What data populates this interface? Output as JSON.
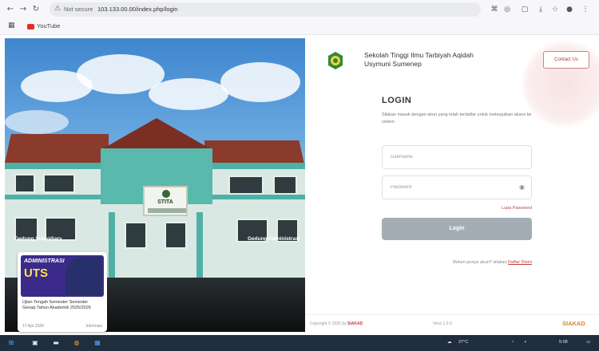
{
  "browser": {
    "url_security": "Not secure",
    "url": "103.133.00.00/index.php/login",
    "bookmark_label": "YouTube",
    "right_icons": [
      "translate-icon",
      "extension-icon",
      "sidebar-icon",
      "download-icon",
      "star-icon",
      "profile-icon",
      "menu-icon"
    ]
  },
  "hero": {
    "sign_name": "STITA",
    "caption_left": "Gedung Subsidiary",
    "caption_right": "Gedung Administrasi",
    "card": {
      "banner_line1": "ADMINISTRASI",
      "banner_line2": "UTS",
      "title": "Ujian Tengah Semester Semester Genap Tahun Akademik 2025/2026",
      "date": "17 Apr 2026",
      "category": "Informasi"
    }
  },
  "header": {
    "institution": "Sekolah Tinggi Ilmu Tarbiyah Aqidah Usymuni Sumenep",
    "contact_label": "Contact Us"
  },
  "login": {
    "title": "LOGIN",
    "description": "Silakan masuk dengan akun yang telah terdaftar untuk melanjutkan akses ke sistem",
    "username_placeholder": "Username",
    "password_placeholder": "Password",
    "forgot_label": "Lupa Password",
    "button_label": "Login",
    "register_text": "Belum punya akun? silakan",
    "register_link": "Daftar Disini"
  },
  "footer": {
    "copyright": "Copyright © 2025 by",
    "copyright_brand": "SIAKAD",
    "version": "Versi 1.0.0",
    "brand": "SIAKAD"
  },
  "taskbar": {
    "weather": "27°C",
    "time": "5:08"
  },
  "colors": {
    "accent": "#c04141",
    "button": "#a4adb4",
    "taskbar": "#1f2d3d"
  }
}
